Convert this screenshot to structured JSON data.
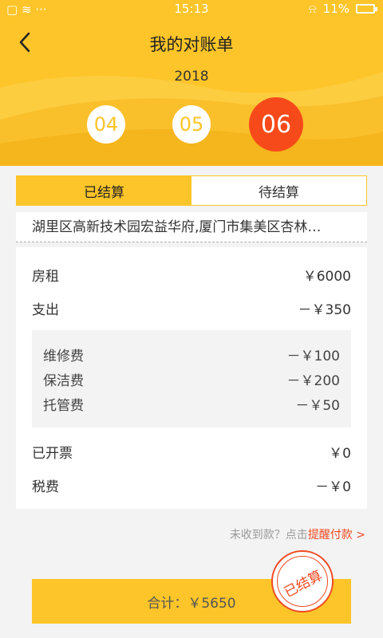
{
  "status_bar": {
    "left_icons": "▢ ≋ ···",
    "time": "15:13",
    "battery_percent": "11%"
  },
  "header": {
    "title": "我的对账单",
    "year": "2018"
  },
  "months": {
    "items": [
      "04",
      "05",
      "06"
    ],
    "selected": "06"
  },
  "tabs": {
    "settled": "已结算",
    "pending": "待结算",
    "active": "settled"
  },
  "address": "湖里区高新技术园宏益华府,厦门市集美区杏林…",
  "bill": {
    "rent_label": "房租",
    "rent_value": "￥6000",
    "expense_label": "支出",
    "expense_value": "－￥350",
    "details": [
      {
        "label": "维修费",
        "value": "－￥100"
      },
      {
        "label": "保洁费",
        "value": "－￥200"
      },
      {
        "label": "托管费",
        "value": "－￥50"
      }
    ],
    "invoiced_label": "已开票",
    "invoiced_value": "￥0",
    "tax_label": "税费",
    "tax_value": "－￥0"
  },
  "reminder": {
    "text": "未收到款？点击",
    "link": "提醒付款 >"
  },
  "total": {
    "text": "合计：￥5650"
  },
  "stamp": {
    "text": "已结算"
  },
  "colors": {
    "accent": "#fdc529",
    "selected_month": "#f74a1a",
    "link": "#f04a22"
  }
}
